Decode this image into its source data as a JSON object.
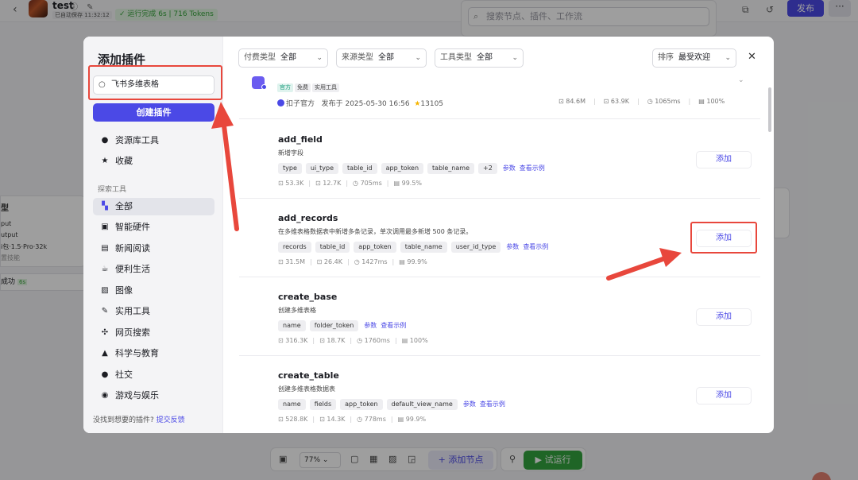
{
  "app": {
    "title": "test",
    "title_icons": "ⓘ ✎",
    "autosave": "已自动保存 11:32:12",
    "run_status": "✓ 运行完成 6s | 716 Tokens",
    "publish": "发布",
    "more": "···"
  },
  "bg_search": {
    "placeholder": "搜索节点、插件、工作流"
  },
  "bg_node_left": {
    "title": "型",
    "line1": "put",
    "line2": "utput",
    "line3": "i包·1.5·Pro·32k",
    "line4": "置技能"
  },
  "bg_success": {
    "label": "成功",
    "tag": "6s"
  },
  "bottom_toolbar": {
    "zoom": "77%",
    "add_node": "+ 添加节点",
    "trial_run": "▶ 试运行"
  },
  "modal": {
    "title": "添加插件",
    "search_value": "飞书多维表格",
    "create_button": "创建插件",
    "sidebar_items": [
      {
        "label": "资源库工具",
        "icon": "user-icon"
      },
      {
        "label": "收藏",
        "icon": "star-icon"
      }
    ],
    "section_label": "探索工具",
    "categories": [
      {
        "label": "全部",
        "icon": "grid-icon",
        "active": true
      },
      {
        "label": "智能硬件",
        "icon": "chip-icon"
      },
      {
        "label": "新闻阅读",
        "icon": "news-icon"
      },
      {
        "label": "便利生活",
        "icon": "cup-icon"
      },
      {
        "label": "图像",
        "icon": "image-icon"
      },
      {
        "label": "实用工具",
        "icon": "wrench-icon"
      },
      {
        "label": "网页搜索",
        "icon": "network-icon"
      },
      {
        "label": "科学与教育",
        "icon": "graduation-icon"
      },
      {
        "label": "社交",
        "icon": "chat-icon"
      },
      {
        "label": "游戏与娱乐",
        "icon": "gamepad-icon"
      }
    ],
    "feedback_text": "没找到想要的插件?",
    "feedback_link": "提交反馈",
    "filters": [
      {
        "label": "付费类型",
        "value": "全部"
      },
      {
        "label": "来源类型",
        "value": "全部"
      },
      {
        "label": "工具类型",
        "value": "全部"
      }
    ],
    "sort": {
      "label": "排序",
      "value": "最受欢迎"
    },
    "plugin": {
      "tags": [
        "官方",
        "免费",
        "实用工具"
      ],
      "author": "扣子官方",
      "published": "发布于 2025-05-30 16:56",
      "stars": "13105",
      "stats": [
        "84.6M",
        "63.9K",
        "1065ms",
        "100%"
      ]
    },
    "tools": [
      {
        "name": "add_field",
        "desc": "新增字段",
        "params": [
          "type",
          "ui_type",
          "table_id",
          "app_token",
          "table_name",
          "+2"
        ],
        "links": [
          "参数",
          "查看示例"
        ],
        "stats": [
          "53.3K",
          "12.7K",
          "705ms",
          "99.5%"
        ],
        "add": "添加"
      },
      {
        "name": "add_records",
        "desc": "在多维表格数据表中新增多条记录，单次调用最多新增 500 条记录。",
        "params": [
          "records",
          "table_id",
          "app_token",
          "table_name",
          "user_id_type"
        ],
        "links": [
          "参数",
          "查看示例"
        ],
        "stats": [
          "31.5M",
          "26.4K",
          "1427ms",
          "99.9%"
        ],
        "add": "添加"
      },
      {
        "name": "create_base",
        "desc": "创建多维表格",
        "params": [
          "name",
          "folder_token"
        ],
        "links": [
          "参数",
          "查看示例"
        ],
        "stats": [
          "316.3K",
          "18.7K",
          "1760ms",
          "100%"
        ],
        "add": "添加"
      },
      {
        "name": "create_table",
        "desc": "创建多维表格数据表",
        "params": [
          "name",
          "fields",
          "app_token",
          "default_view_name"
        ],
        "links": [
          "参数",
          "查看示例"
        ],
        "stats": [
          "528.8K",
          "14.3K",
          "778ms",
          "99.9%"
        ],
        "add": "添加"
      }
    ]
  },
  "colors": {
    "brand": "#4b49e6",
    "success": "#33a33e",
    "annotation": "#e8473c"
  }
}
